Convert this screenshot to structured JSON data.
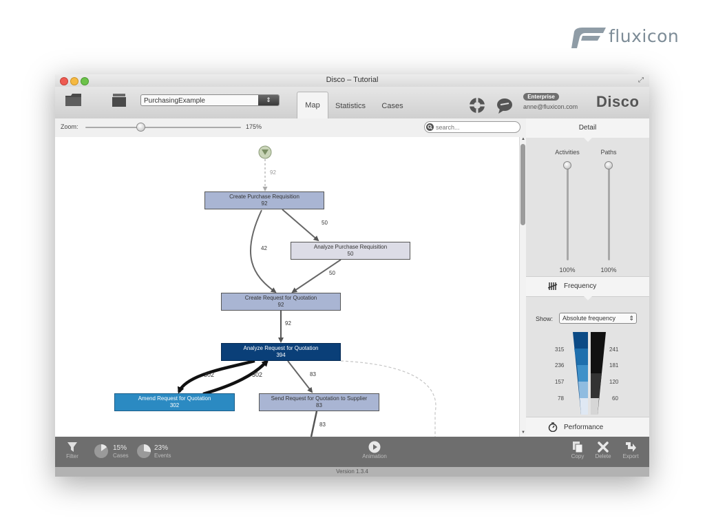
{
  "brand": {
    "name": "fluxicon"
  },
  "window": {
    "title": "Disco – Tutorial"
  },
  "toolbar": {
    "dataset": "PurchasingExample",
    "tabs": [
      {
        "label": "Map"
      },
      {
        "label": "Statistics"
      },
      {
        "label": "Cases"
      }
    ],
    "active_tab": "Map",
    "license_badge": "Enterprise",
    "user_email": "anne@fluxicon.com",
    "app_logo": "Disco"
  },
  "zoom": {
    "label": "Zoom:",
    "value": "175%",
    "level_percent": 175
  },
  "search": {
    "placeholder": "search..."
  },
  "detail_panel": {
    "header": "Detail",
    "activities": {
      "label": "Activities",
      "value": "100%"
    },
    "paths": {
      "label": "Paths",
      "value": "100%"
    },
    "frequency": {
      "label": "Frequency"
    },
    "show_label": "Show:",
    "show_option": "Absolute frequency",
    "activity_scale": [
      "315",
      "236",
      "157",
      "78"
    ],
    "path_scale": [
      "241",
      "181",
      "120",
      "60"
    ],
    "performance": {
      "label": "Performance"
    }
  },
  "process_map": {
    "nodes": [
      {
        "name": "Create Purchase Requisition",
        "count": "92"
      },
      {
        "name": "Analyze Purchase Requisition",
        "count": "50"
      },
      {
        "name": "Create Request for Quotation",
        "count": "92"
      },
      {
        "name": "Analyze Request for Quotation",
        "count": "394"
      },
      {
        "name": "Amend Request for Quotation",
        "count": "302"
      },
      {
        "name": "Send Request for Quotation to Supplier",
        "count": "83"
      }
    ],
    "edges": [
      {
        "from": "start",
        "to": "Create Purchase Requisition",
        "label": "92"
      },
      {
        "from": "Create Purchase Requisition",
        "to": "Analyze Purchase Requisition",
        "label": "50"
      },
      {
        "from": "Create Purchase Requisition",
        "to": "Create Request for Quotation",
        "label": "42"
      },
      {
        "from": "Analyze Purchase Requisition",
        "to": "Create Request for Quotation",
        "label": "50"
      },
      {
        "from": "Create Request for Quotation",
        "to": "Analyze Request for Quotation",
        "label": "92"
      },
      {
        "from": "Analyze Request for Quotation",
        "to": "Amend Request for Quotation",
        "label": "302"
      },
      {
        "from": "Amend Request for Quotation",
        "to": "Analyze Request for Quotation",
        "label": "302"
      },
      {
        "from": "Analyze Request for Quotation",
        "to": "Send Request for Quotation to Supplier",
        "label": "83"
      },
      {
        "from": "Send Request for Quotation to Supplier",
        "to": "next",
        "label": "83"
      }
    ]
  },
  "bottom_bar": {
    "filter": "Filter",
    "cases_percent": "15%",
    "cases_label": "Cases",
    "events_percent": "23%",
    "events_label": "Events",
    "animation": "Animation",
    "copy": "Copy",
    "delete": "Delete",
    "export": "Export"
  },
  "version": "Version 1.3.4",
  "colors": {
    "node_light": "#a9b5d3",
    "node_pale": "#dcdce6",
    "node_dark": "#0a3f78",
    "node_medium": "#2b8ac2",
    "bottom_bar": "#6e6e6e"
  },
  "icons": [
    "folder-icon",
    "layers-icon",
    "help-lifebuoy-icon",
    "feedback-icon",
    "search-icon",
    "frequency-icon",
    "performance-icon",
    "filter-icon",
    "animation-icon",
    "copy-icon",
    "delete-icon",
    "export-icon",
    "start-node-icon"
  ]
}
